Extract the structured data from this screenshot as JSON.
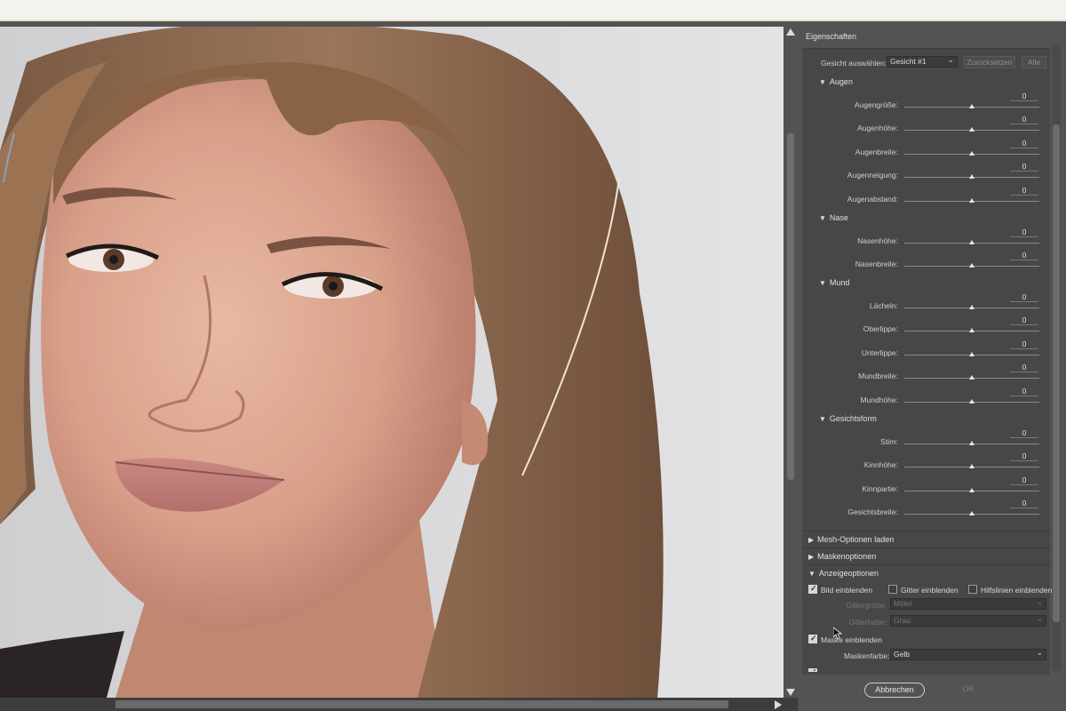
{
  "panel": {
    "title": "Eigenschaften",
    "face_select_label": "Gesicht auswählen:",
    "face_select_value": "Gesicht #1",
    "reset_label": "Zurücksetzen",
    "all_label": "Alle"
  },
  "sections": [
    {
      "title": "Augen",
      "rows": [
        {
          "label": "Augengröße:",
          "value": "0"
        },
        {
          "label": "Augenhöhe:",
          "value": "0"
        },
        {
          "label": "Augenbreite:",
          "value": "0"
        },
        {
          "label": "Augenneigung:",
          "value": "0"
        },
        {
          "label": "Augenabstand:",
          "value": "0"
        }
      ]
    },
    {
      "title": "Nase",
      "rows": [
        {
          "label": "Nasenhöhe:",
          "value": "0"
        },
        {
          "label": "Nasenbreite:",
          "value": "0"
        }
      ]
    },
    {
      "title": "Mund",
      "rows": [
        {
          "label": "Lächeln:",
          "value": "0"
        },
        {
          "label": "Oberlippe:",
          "value": "0"
        },
        {
          "label": "Unterlippe:",
          "value": "0"
        },
        {
          "label": "Mundbreite:",
          "value": "0"
        },
        {
          "label": "Mundhöhe:",
          "value": "0"
        }
      ]
    },
    {
      "title": "Gesichtsform",
      "rows": [
        {
          "label": "Stirn:",
          "value": "0"
        },
        {
          "label": "Kinnhöhe:",
          "value": "0"
        },
        {
          "label": "Kinnpartie:",
          "value": "0"
        },
        {
          "label": "Gesichtsbreite:",
          "value": "0"
        }
      ]
    }
  ],
  "collapsed": {
    "mesh": "Mesh-Optionen laden",
    "mask": "Maskenoptionen"
  },
  "display": {
    "title": "Anzeigeoptionen",
    "show_image": "Bild einblenden",
    "show_grid": "Gitter einblenden",
    "show_guides": "Hilfslinien einblenden",
    "grid_size_label": "Gittergröße:",
    "grid_size_value": "Mittel",
    "grid_color_label": "Gitterfarbe:",
    "grid_color_value": "Grau",
    "show_mask": "Maske einblenden",
    "mask_color_label": "Maskenfarbe:",
    "mask_color_value": "Gelb"
  },
  "footer": {
    "cancel": "Abbrechen",
    "ok": "OK"
  },
  "colors": {
    "panel_bg": "#535353",
    "panel_inner": "#474747",
    "slider_knob": "#e6e6e6"
  }
}
